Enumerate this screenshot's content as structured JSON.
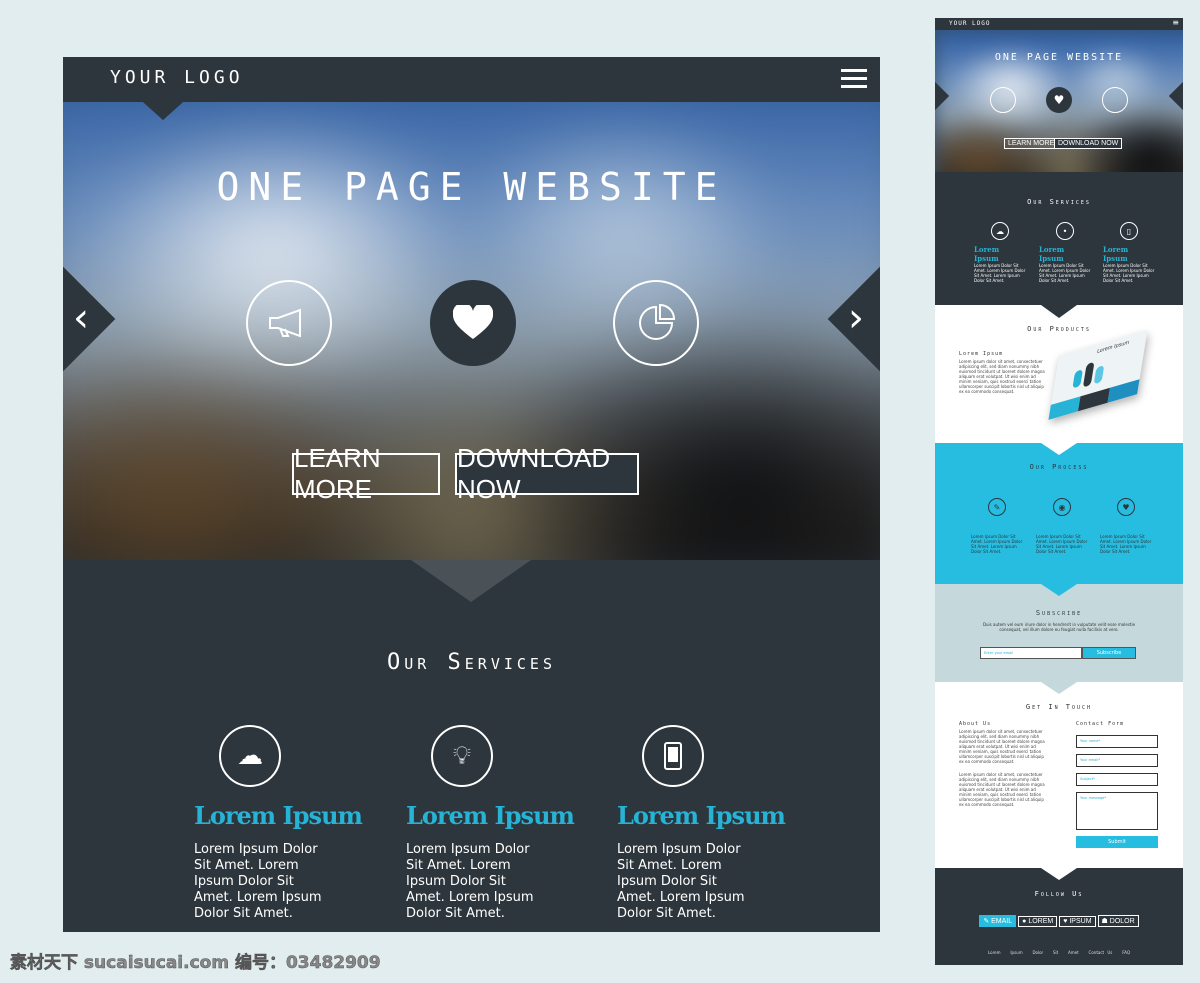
{
  "main": {
    "logo": "YOUR LOGO",
    "hero_title": "ONE PAGE WEBSITE",
    "hero_icons": [
      "megaphone-icon",
      "heart-icon",
      "pie-chart-icon"
    ],
    "learn_more": "LEARN MORE",
    "download_now": "DOWNLOAD NOW",
    "services_title": "Our Services",
    "services": [
      {
        "icon": "cloud-icon",
        "title": "Lorem Ipsum",
        "text": "Lorem Ipsum Dolor Sit Amet. Lorem Ipsum Dolor Sit Amet. Lorem Ipsum Dolor Sit Amet."
      },
      {
        "icon": "lightbulb-icon",
        "title": "Lorem Ipsum",
        "text": "Lorem Ipsum Dolor Sit Amet. Lorem Ipsum Dolor Sit Amet. Lorem Ipsum Dolor Sit Amet."
      },
      {
        "icon": "smartphone-icon",
        "title": "Lorem Ipsum",
        "text": "Lorem Ipsum Dolor Sit Amet. Lorem Ipsum Dolor Sit Amet. Lorem Ipsum Dolor Sit Amet."
      }
    ]
  },
  "mini": {
    "logo": "YOUR LOGO",
    "hero_title": "ONE PAGE WEBSITE",
    "learn_more": "LEARN MORE",
    "download_now": "DOWNLOAD NOW",
    "services_title": "Our Services",
    "service_title": "Lorem Ipsum",
    "service_text": "Lorem Ipsum Dolor Sit Amet. Lorem Ipsum Dolor Sit Amet. Lorem Ipsum Dolor Sit Amet.",
    "products_title": "Our Products",
    "products_subtitle": "Lorem Ipsum",
    "lorem_paragraph": "Lorem ipsum dolor sit amet, consectetuer adipiscing elit, sed diam nonummy nibh euismod tincidunt ut laoreet dolore magna aliquam erat volutpat. Ut wisi enim ad minim veniam, quis nostrud exerci tation ullamcorper suscipit lobortis nisl ut aliquip ex ea commodo consequat.",
    "product_card_title": "Lorem Ipsum",
    "process_title": "Our Process",
    "process_text": "Lorem Ipsum Dolor Sit Amet. Lorem Ipsum Dolor Sit Amet. Lorem Ipsum Dolor Sit Amet.",
    "subscribe_title": "Subscribe",
    "subscribe_text": "Duis autem vel eum iriure dolor in hendrerit in vulputate velit esse molestie consequat, vel illum dolore eu feugiat nulla facilisis at vero.",
    "email_placeholder": "Enter your email",
    "subscribe_button": "Subscribe",
    "contact_title": "Get In Touch",
    "about_title": "About Us",
    "contact_form_title": "Contact Form",
    "name_placeholder": "Your name*",
    "email_field_placeholder": "Your email*",
    "subject_placeholder": "Subject*",
    "message_placeholder": "Your message*",
    "submit": "Submit",
    "follow_title": "Follow Us",
    "social": [
      "EMAIL",
      "LOREM",
      "IPSUM",
      "DOLOR"
    ],
    "footer_links": [
      "Lorem",
      "Ipsum",
      "Dolor",
      "Sit",
      "Amet",
      "Contact Us",
      "FAQ"
    ]
  },
  "colors": {
    "dark": "#2d363c",
    "accent": "#27b3d6",
    "subscribe_bg": "#c5d9dc"
  },
  "watermark": "素材天下 sucaisucai.com   编号：03482909"
}
